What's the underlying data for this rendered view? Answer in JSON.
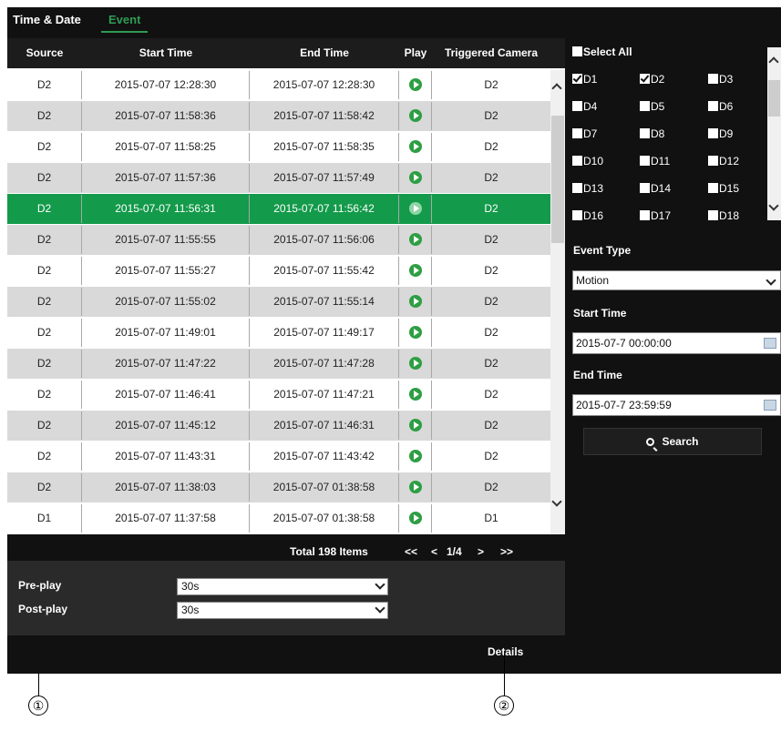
{
  "tabs": [
    {
      "label": "Time & Date"
    },
    {
      "label": "Event"
    }
  ],
  "table": {
    "headers": {
      "source": "Source",
      "start": "Start Time",
      "end": "End Time",
      "play": "Play",
      "triggered": "Triggered Camera"
    },
    "selected_index": 4,
    "rows": [
      {
        "source": "D2",
        "start": "2015-07-07 12:28:30",
        "end": "2015-07-07 12:28:30",
        "triggered": "D2"
      },
      {
        "source": "D2",
        "start": "2015-07-07 11:58:36",
        "end": "2015-07-07 11:58:42",
        "triggered": "D2"
      },
      {
        "source": "D2",
        "start": "2015-07-07 11:58:25",
        "end": "2015-07-07 11:58:35",
        "triggered": "D2"
      },
      {
        "source": "D2",
        "start": "2015-07-07 11:57:36",
        "end": "2015-07-07 11:57:49",
        "triggered": "D2"
      },
      {
        "source": "D2",
        "start": "2015-07-07 11:56:31",
        "end": "2015-07-07 11:56:42",
        "triggered": "D2"
      },
      {
        "source": "D2",
        "start": "2015-07-07 11:55:55",
        "end": "2015-07-07 11:56:06",
        "triggered": "D2"
      },
      {
        "source": "D2",
        "start": "2015-07-07 11:55:27",
        "end": "2015-07-07 11:55:42",
        "triggered": "D2"
      },
      {
        "source": "D2",
        "start": "2015-07-07 11:55:02",
        "end": "2015-07-07 11:55:14",
        "triggered": "D2"
      },
      {
        "source": "D2",
        "start": "2015-07-07 11:49:01",
        "end": "2015-07-07 11:49:17",
        "triggered": "D2"
      },
      {
        "source": "D2",
        "start": "2015-07-07 11:47:22",
        "end": "2015-07-07 11:47:28",
        "triggered": "D2"
      },
      {
        "source": "D2",
        "start": "2015-07-07 11:46:41",
        "end": "2015-07-07 11:47:21",
        "triggered": "D2"
      },
      {
        "source": "D2",
        "start": "2015-07-07 11:45:12",
        "end": "2015-07-07 11:46:31",
        "triggered": "D2"
      },
      {
        "source": "D2",
        "start": "2015-07-07 11:43:31",
        "end": "2015-07-07 11:43:42",
        "triggered": "D2"
      },
      {
        "source": "D2",
        "start": "2015-07-07 11:38:03",
        "end": "2015-07-07 01:38:58",
        "triggered": "D2"
      },
      {
        "source": "D1",
        "start": "2015-07-07 11:37:58",
        "end": "2015-07-07 01:38:58",
        "triggered": "D1"
      }
    ]
  },
  "pager": {
    "total": "Total 198 Items",
    "first": "<<",
    "prev": "<",
    "page": "1/4",
    "next": ">",
    "last": ">>"
  },
  "playopts": {
    "preplay_label": "Pre-play",
    "preplay_value": "30s",
    "postplay_label": "Post-play",
    "postplay_value": "30s"
  },
  "details_label": "Details",
  "cameras": {
    "select_all": "Select All",
    "items": [
      {
        "label": "D1",
        "checked": true
      },
      {
        "label": "D2",
        "checked": true
      },
      {
        "label": "D3",
        "checked": false
      },
      {
        "label": "D4",
        "checked": false
      },
      {
        "label": "D5",
        "checked": false
      },
      {
        "label": "D6",
        "checked": false
      },
      {
        "label": "D7",
        "checked": false
      },
      {
        "label": "D8",
        "checked": false
      },
      {
        "label": "D9",
        "checked": false
      },
      {
        "label": "D10",
        "checked": false
      },
      {
        "label": "D11",
        "checked": false
      },
      {
        "label": "D12",
        "checked": false
      },
      {
        "label": "D13",
        "checked": false
      },
      {
        "label": "D14",
        "checked": false
      },
      {
        "label": "D15",
        "checked": false
      },
      {
        "label": "D16",
        "checked": false
      },
      {
        "label": "D17",
        "checked": false
      },
      {
        "label": "D18",
        "checked": false
      }
    ]
  },
  "filters": {
    "event_type_label": "Event Type",
    "event_type_value": "Motion",
    "start_label": "Start Time",
    "start_value": "2015-07-7 00:00:00",
    "end_label": "End Time",
    "end_value": "2015-07-7 23:59:59",
    "search_label": "Search"
  },
  "callouts": [
    "①",
    "②"
  ],
  "colors": {
    "selected_row": "#139a4a",
    "active_tab": "#2f9b54",
    "play_icon": "#2e9e44"
  }
}
